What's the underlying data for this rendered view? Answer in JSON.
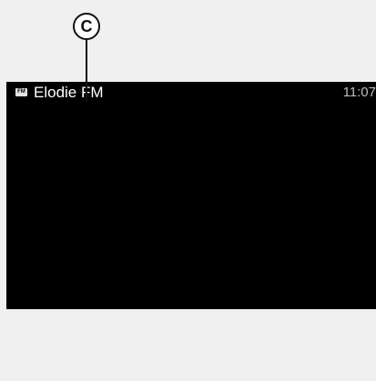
{
  "callout": {
    "label": "C"
  },
  "status_bar": {
    "source_icon": {
      "name": "fm-radio-icon",
      "text": "FM"
    },
    "station_name": "Elodie FM",
    "time": "11:07"
  },
  "colors": {
    "screen_background": "#000000",
    "page_background": "#f0f0f0",
    "station_text": "#ffffff",
    "time_text": "#bdbdbd"
  }
}
